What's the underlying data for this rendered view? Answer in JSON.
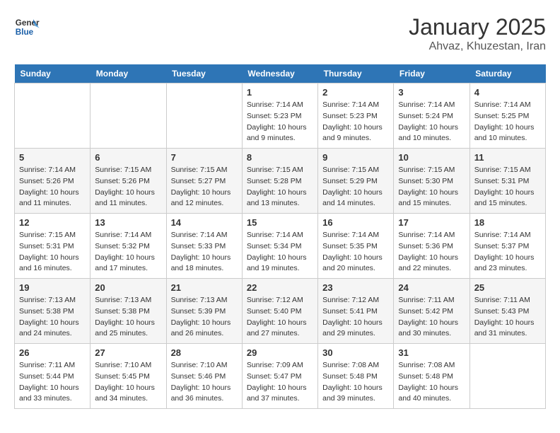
{
  "header": {
    "logo_line1": "General",
    "logo_line2": "Blue",
    "month": "January 2025",
    "location": "Ahvaz, Khuzestan, Iran"
  },
  "days_of_week": [
    "Sunday",
    "Monday",
    "Tuesday",
    "Wednesday",
    "Thursday",
    "Friday",
    "Saturday"
  ],
  "weeks": [
    [
      {
        "day": "",
        "info": ""
      },
      {
        "day": "",
        "info": ""
      },
      {
        "day": "",
        "info": ""
      },
      {
        "day": "1",
        "sunrise": "7:14 AM",
        "sunset": "5:23 PM",
        "daylight": "10 hours and 9 minutes."
      },
      {
        "day": "2",
        "sunrise": "7:14 AM",
        "sunset": "5:23 PM",
        "daylight": "10 hours and 9 minutes."
      },
      {
        "day": "3",
        "sunrise": "7:14 AM",
        "sunset": "5:24 PM",
        "daylight": "10 hours and 10 minutes."
      },
      {
        "day": "4",
        "sunrise": "7:14 AM",
        "sunset": "5:25 PM",
        "daylight": "10 hours and 10 minutes."
      }
    ],
    [
      {
        "day": "5",
        "sunrise": "7:14 AM",
        "sunset": "5:26 PM",
        "daylight": "10 hours and 11 minutes."
      },
      {
        "day": "6",
        "sunrise": "7:15 AM",
        "sunset": "5:26 PM",
        "daylight": "10 hours and 11 minutes."
      },
      {
        "day": "7",
        "sunrise": "7:15 AM",
        "sunset": "5:27 PM",
        "daylight": "10 hours and 12 minutes."
      },
      {
        "day": "8",
        "sunrise": "7:15 AM",
        "sunset": "5:28 PM",
        "daylight": "10 hours and 13 minutes."
      },
      {
        "day": "9",
        "sunrise": "7:15 AM",
        "sunset": "5:29 PM",
        "daylight": "10 hours and 14 minutes."
      },
      {
        "day": "10",
        "sunrise": "7:15 AM",
        "sunset": "5:30 PM",
        "daylight": "10 hours and 15 minutes."
      },
      {
        "day": "11",
        "sunrise": "7:15 AM",
        "sunset": "5:31 PM",
        "daylight": "10 hours and 15 minutes."
      }
    ],
    [
      {
        "day": "12",
        "sunrise": "7:15 AM",
        "sunset": "5:31 PM",
        "daylight": "10 hours and 16 minutes."
      },
      {
        "day": "13",
        "sunrise": "7:14 AM",
        "sunset": "5:32 PM",
        "daylight": "10 hours and 17 minutes."
      },
      {
        "day": "14",
        "sunrise": "7:14 AM",
        "sunset": "5:33 PM",
        "daylight": "10 hours and 18 minutes."
      },
      {
        "day": "15",
        "sunrise": "7:14 AM",
        "sunset": "5:34 PM",
        "daylight": "10 hours and 19 minutes."
      },
      {
        "day": "16",
        "sunrise": "7:14 AM",
        "sunset": "5:35 PM",
        "daylight": "10 hours and 20 minutes."
      },
      {
        "day": "17",
        "sunrise": "7:14 AM",
        "sunset": "5:36 PM",
        "daylight": "10 hours and 22 minutes."
      },
      {
        "day": "18",
        "sunrise": "7:14 AM",
        "sunset": "5:37 PM",
        "daylight": "10 hours and 23 minutes."
      }
    ],
    [
      {
        "day": "19",
        "sunrise": "7:13 AM",
        "sunset": "5:38 PM",
        "daylight": "10 hours and 24 minutes."
      },
      {
        "day": "20",
        "sunrise": "7:13 AM",
        "sunset": "5:38 PM",
        "daylight": "10 hours and 25 minutes."
      },
      {
        "day": "21",
        "sunrise": "7:13 AM",
        "sunset": "5:39 PM",
        "daylight": "10 hours and 26 minutes."
      },
      {
        "day": "22",
        "sunrise": "7:12 AM",
        "sunset": "5:40 PM",
        "daylight": "10 hours and 27 minutes."
      },
      {
        "day": "23",
        "sunrise": "7:12 AM",
        "sunset": "5:41 PM",
        "daylight": "10 hours and 29 minutes."
      },
      {
        "day": "24",
        "sunrise": "7:11 AM",
        "sunset": "5:42 PM",
        "daylight": "10 hours and 30 minutes."
      },
      {
        "day": "25",
        "sunrise": "7:11 AM",
        "sunset": "5:43 PM",
        "daylight": "10 hours and 31 minutes."
      }
    ],
    [
      {
        "day": "26",
        "sunrise": "7:11 AM",
        "sunset": "5:44 PM",
        "daylight": "10 hours and 33 minutes."
      },
      {
        "day": "27",
        "sunrise": "7:10 AM",
        "sunset": "5:45 PM",
        "daylight": "10 hours and 34 minutes."
      },
      {
        "day": "28",
        "sunrise": "7:10 AM",
        "sunset": "5:46 PM",
        "daylight": "10 hours and 36 minutes."
      },
      {
        "day": "29",
        "sunrise": "7:09 AM",
        "sunset": "5:47 PM",
        "daylight": "10 hours and 37 minutes."
      },
      {
        "day": "30",
        "sunrise": "7:08 AM",
        "sunset": "5:48 PM",
        "daylight": "10 hours and 39 minutes."
      },
      {
        "day": "31",
        "sunrise": "7:08 AM",
        "sunset": "5:48 PM",
        "daylight": "10 hours and 40 minutes."
      },
      {
        "day": "",
        "info": ""
      }
    ]
  ]
}
